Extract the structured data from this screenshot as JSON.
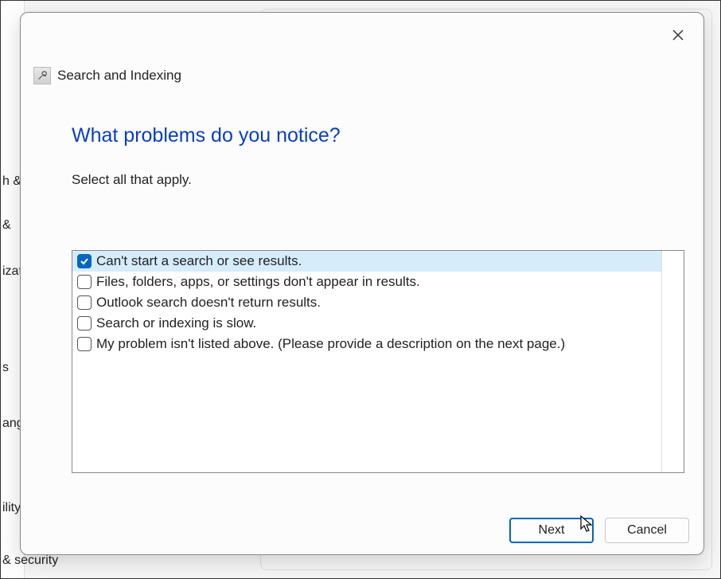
{
  "dialog": {
    "title": "Search and Indexing",
    "heading": "What problems do you notice?",
    "subheading": "Select all that apply.",
    "options": [
      {
        "label": "Can't start a search or see results.",
        "checked": true
      },
      {
        "label": "Files, folders, apps, or settings don't appear in results.",
        "checked": false
      },
      {
        "label": "Outlook search doesn't return results.",
        "checked": false
      },
      {
        "label": "Search or indexing is slow.",
        "checked": false
      },
      {
        "label": "My problem isn't listed above. (Please provide a description on the next page.)",
        "checked": false
      }
    ],
    "buttons": {
      "next": "Next",
      "cancel": "Cancel"
    }
  },
  "background": {
    "items": [
      "h &",
      " & ",
      "izat",
      "s",
      "ang",
      "ility",
      "& security"
    ]
  }
}
